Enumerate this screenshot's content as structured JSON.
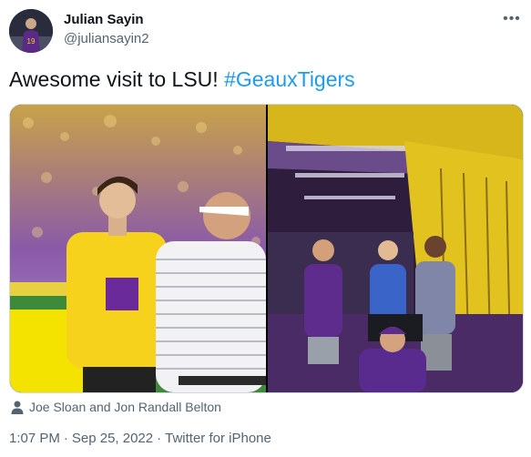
{
  "author": {
    "display_name": "Julian Sayin",
    "handle": "@juliansayin2"
  },
  "more_icon": "more-dots-icon",
  "tweet": {
    "text": "Awesome visit to LSU!",
    "hashtag": "#GeauxTigers"
  },
  "media": {
    "photo_count": 2
  },
  "tags": {
    "icon": "person-icon",
    "people": "Joe Sloan and Jon Randall Belton"
  },
  "meta": {
    "time": "1:07 PM",
    "separator": "·",
    "date": "Sep 25, 2022",
    "source": "Twitter for iPhone"
  },
  "colors": {
    "link": "#1d9bf0",
    "secondary_text": "#536471",
    "primary_text": "#0f1419"
  }
}
